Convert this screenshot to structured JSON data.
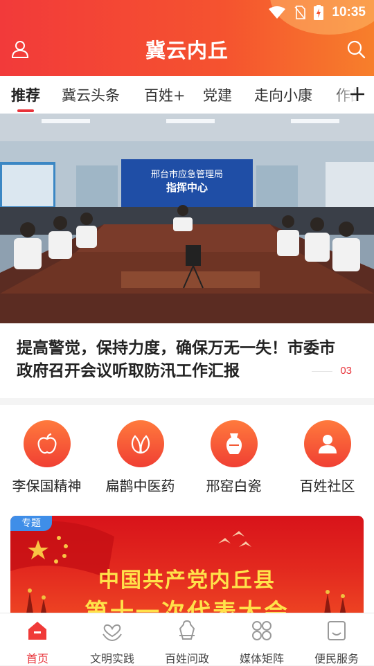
{
  "status_bar": {
    "time": "10:35"
  },
  "header": {
    "title": "冀云内丘"
  },
  "tabs": [
    {
      "label": "推荐",
      "active": true
    },
    {
      "label": "冀云头条"
    },
    {
      "label": "百姓+"
    },
    {
      "label": "党建"
    },
    {
      "label": "走向小康"
    },
    {
      "label": "作品"
    }
  ],
  "hero": {
    "sign_line1": "邢台市应急管理局",
    "sign_line2": "指挥中心",
    "headline": "提高警觉，保持力度，确保万无一失！市委市政府召开会议听取防汛工作汇报",
    "slide_number": "03"
  },
  "shortcuts": [
    {
      "label": "李保国精神",
      "icon": "apple-icon"
    },
    {
      "label": "扁鹊中医药",
      "icon": "leaf-icon"
    },
    {
      "label": "邢窑白瓷",
      "icon": "vase-icon"
    },
    {
      "label": "百姓社区",
      "icon": "person-icon"
    }
  ],
  "special": {
    "badge": "专题",
    "line1": "中国共产党内丘县",
    "line2": "第十一次代表大会"
  },
  "bottom_nav": [
    {
      "label": "首页",
      "icon": "home-icon",
      "active": true
    },
    {
      "label": "文明实践",
      "icon": "heart-hands-icon"
    },
    {
      "label": "百姓问政",
      "icon": "question-icon"
    },
    {
      "label": "媒体矩阵",
      "icon": "grid-icon"
    },
    {
      "label": "便民服务",
      "icon": "service-icon"
    }
  ],
  "colors": {
    "brand_red": "#e8333a",
    "header_orange": "#f77f2b"
  }
}
